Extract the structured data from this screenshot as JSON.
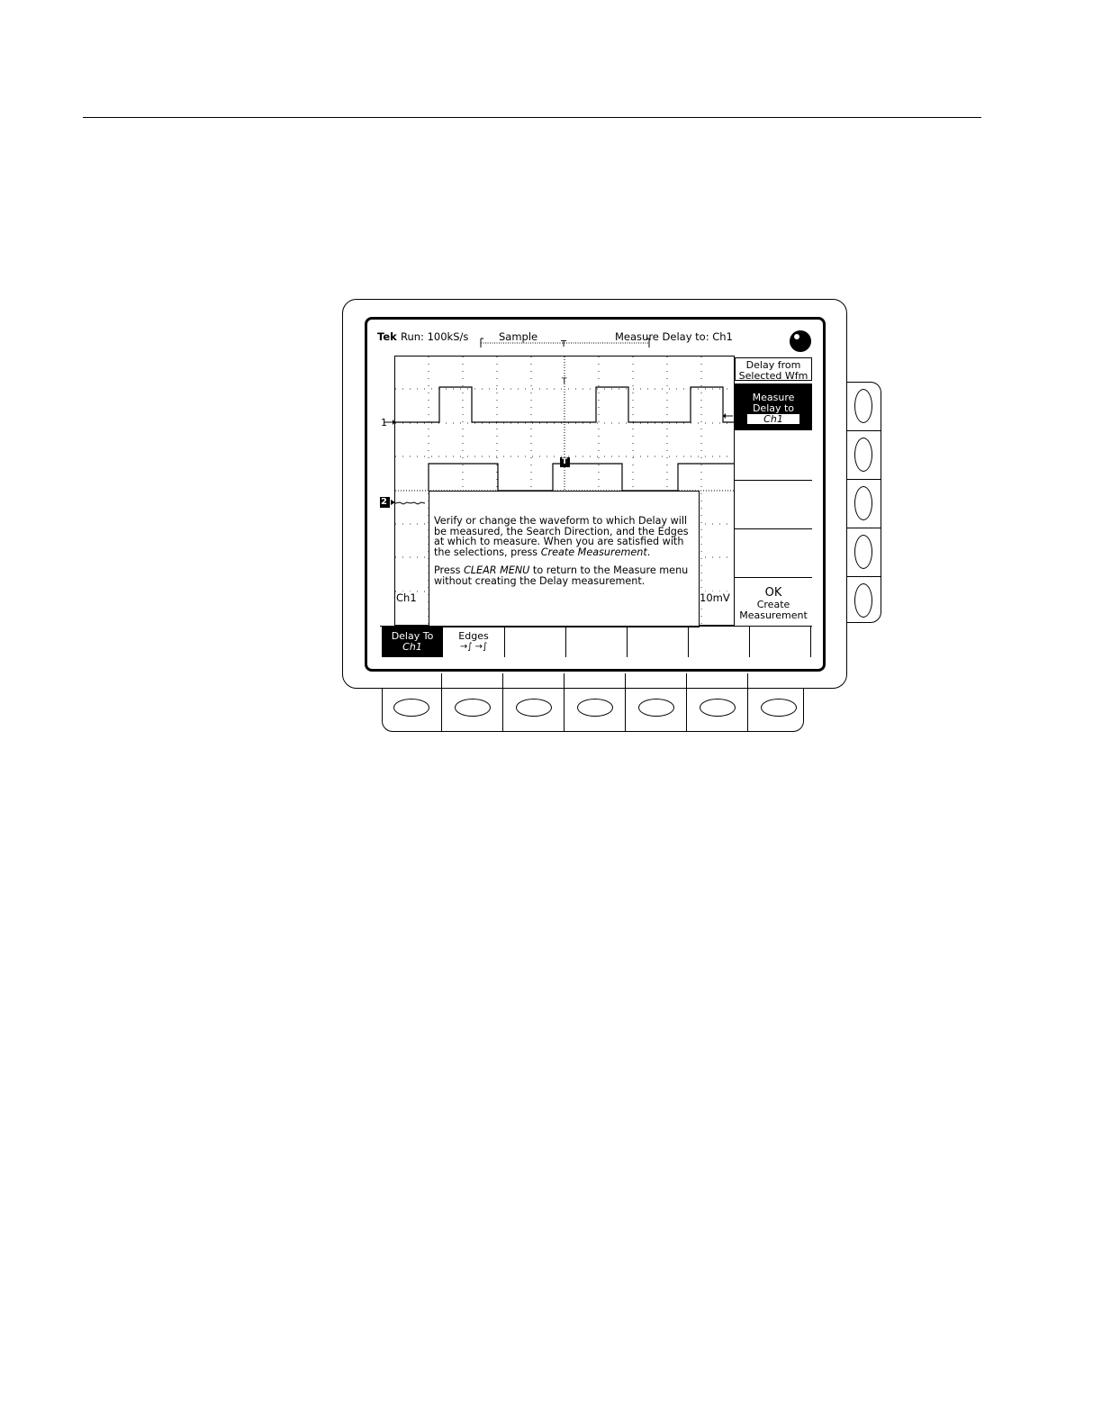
{
  "status_bar": {
    "brand": "Tek",
    "run_state": "Run: 100kS/s",
    "acq_mode": "Sample",
    "measure_info": "Measure Delay to: Ch1",
    "trigger_marker": "T"
  },
  "display": {
    "ch1_marker": "1",
    "ch2_marker": "2",
    "trigger_pos_marker": "T",
    "ch2_trigger_marker": "T",
    "channel_readout": "Ch1",
    "scale_readout": "10mV"
  },
  "help_text": {
    "paragraph1_plain": "Verify or change the waveform to which Delay will be measured, the Search  Direction, and the Edges at which to measure. When you are satisfied with the  selections, press ",
    "paragraph1_italic": "Create Measurement",
    "paragraph1_end": ".",
    "paragraph2_start": "Press ",
    "paragraph2_italic": "CLEAR MENU",
    "paragraph2_end": " to return to the Measure menu without creating the Delay measurement."
  },
  "side_menu": {
    "item1_line1": "Delay from",
    "item1_line2": "Selected Wfm",
    "item2_line1": "Measure",
    "item2_line2": "Delay to",
    "item2_value": "Ch1",
    "item5_line1": "OK",
    "item5_line2": "Create",
    "item5_line3": "Measurement"
  },
  "bottom_menu": {
    "item1_label": "Delay To",
    "item1_value": "Ch1",
    "item2_label": "Edges",
    "item2_value": "→∫ →∫"
  }
}
